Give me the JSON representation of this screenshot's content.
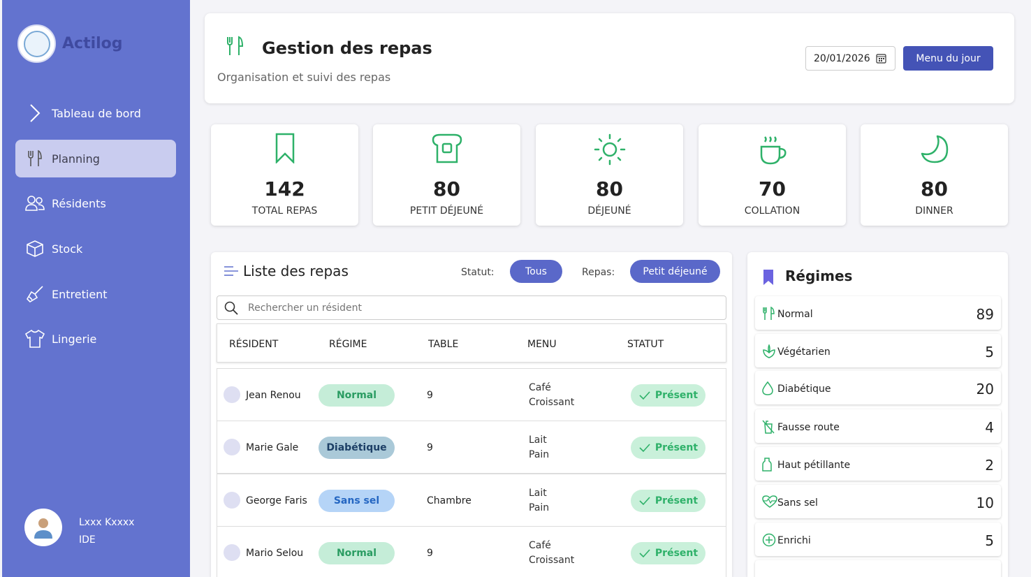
{
  "app": {
    "name": "Actilog"
  },
  "sidebar": {
    "items": [
      {
        "label": "Tableau de bord",
        "icon": "chevron-right-icon"
      },
      {
        "label": "Planning",
        "icon": "fork-knife-icon",
        "active": true
      },
      {
        "label": "Résidents",
        "icon": "users-icon"
      },
      {
        "label": "Stock",
        "icon": "box-icon"
      },
      {
        "label": "Entretient",
        "icon": "broom-icon"
      },
      {
        "label": "Lingerie",
        "icon": "shirt-icon"
      }
    ],
    "user": {
      "name": "Lxxx Kxxxx",
      "role": "IDE"
    }
  },
  "header": {
    "title": "Gestion des repas",
    "subtitle": "Organisation et suivi des repas",
    "date": "20/01/2026",
    "menu_button": "Menu du jour"
  },
  "stats": [
    {
      "value": "142",
      "label": "TOTAL REPAS",
      "icon": "bookmark-icon"
    },
    {
      "value": "80",
      "label": "PETIT DÉJEUNÉ",
      "icon": "bread-icon"
    },
    {
      "value": "80",
      "label": "DÉJEUNÉ",
      "icon": "sun-icon"
    },
    {
      "value": "70",
      "label": "COLLATION",
      "icon": "coffee-cup-icon"
    },
    {
      "value": "80",
      "label": "DINNER",
      "icon": "moon-icon"
    }
  ],
  "meals": {
    "title": "Liste des repas",
    "statut_label": "Statut:",
    "statut_value": "Tous",
    "repas_label": "Repas:",
    "repas_value": "Petit déjeuné",
    "search_placeholder": "Rechercher un résident",
    "columns": [
      "RÉSIDENT",
      "RÉGIME",
      "TABLE",
      "MENU",
      "STATUT"
    ],
    "rows": [
      {
        "name": "Jean Renou",
        "regime": "Normal",
        "table": "9",
        "menu1": "Café",
        "menu2": "Croissant",
        "statut": "Présent"
      },
      {
        "name": "Marie Gale",
        "regime": "Diabétique",
        "table": "9",
        "menu1": "Lait",
        "menu2": "Pain",
        "statut": "Présent"
      },
      {
        "name": "George Faris",
        "regime": "Sans sel",
        "table": "Chambre",
        "menu1": "Lait",
        "menu2": "Pain",
        "statut": "Présent"
      },
      {
        "name": "Mario Selou",
        "regime": "Normal",
        "table": "9",
        "menu1": "Café",
        "menu2": "Croissant",
        "statut": "Présent"
      }
    ]
  },
  "regimes": {
    "title": "Régimes",
    "items": [
      {
        "name": "Normal",
        "count": "89",
        "icon": "fork-knife-icon"
      },
      {
        "name": "Végétarien",
        "count": "5",
        "icon": "leaf-icon"
      },
      {
        "name": "Diabétique",
        "count": "20",
        "icon": "drop-icon"
      },
      {
        "name": "Fausse route",
        "count": "4",
        "icon": "no-drink-icon"
      },
      {
        "name": "Haut pétillante",
        "count": "2",
        "icon": "bottle-icon"
      },
      {
        "name": "Sans sel",
        "count": "10",
        "icon": "heart-pulse-icon"
      },
      {
        "name": "Enrichi",
        "count": "5",
        "icon": "plus-circle-icon"
      }
    ]
  },
  "colors": {
    "sidebar": "#6373cf",
    "accent": "#4453b6",
    "green": "#2eb169"
  }
}
